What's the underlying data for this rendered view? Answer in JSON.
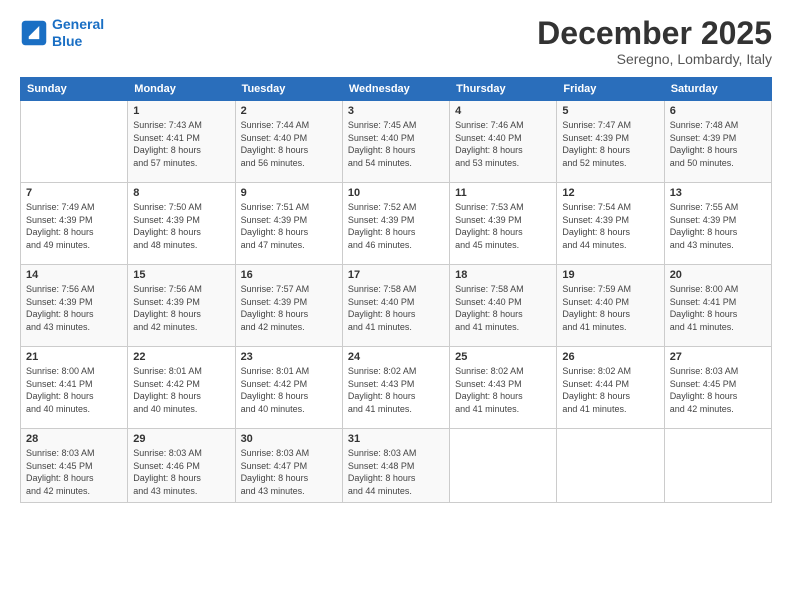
{
  "header": {
    "logo_line1": "General",
    "logo_line2": "Blue",
    "month": "December 2025",
    "location": "Seregno, Lombardy, Italy"
  },
  "weekdays": [
    "Sunday",
    "Monday",
    "Tuesday",
    "Wednesday",
    "Thursday",
    "Friday",
    "Saturday"
  ],
  "weeks": [
    [
      {
        "day": "",
        "info": ""
      },
      {
        "day": "1",
        "info": "Sunrise: 7:43 AM\nSunset: 4:41 PM\nDaylight: 8 hours\nand 57 minutes."
      },
      {
        "day": "2",
        "info": "Sunrise: 7:44 AM\nSunset: 4:40 PM\nDaylight: 8 hours\nand 56 minutes."
      },
      {
        "day": "3",
        "info": "Sunrise: 7:45 AM\nSunset: 4:40 PM\nDaylight: 8 hours\nand 54 minutes."
      },
      {
        "day": "4",
        "info": "Sunrise: 7:46 AM\nSunset: 4:40 PM\nDaylight: 8 hours\nand 53 minutes."
      },
      {
        "day": "5",
        "info": "Sunrise: 7:47 AM\nSunset: 4:39 PM\nDaylight: 8 hours\nand 52 minutes."
      },
      {
        "day": "6",
        "info": "Sunrise: 7:48 AM\nSunset: 4:39 PM\nDaylight: 8 hours\nand 50 minutes."
      }
    ],
    [
      {
        "day": "7",
        "info": "Sunrise: 7:49 AM\nSunset: 4:39 PM\nDaylight: 8 hours\nand 49 minutes."
      },
      {
        "day": "8",
        "info": "Sunrise: 7:50 AM\nSunset: 4:39 PM\nDaylight: 8 hours\nand 48 minutes."
      },
      {
        "day": "9",
        "info": "Sunrise: 7:51 AM\nSunset: 4:39 PM\nDaylight: 8 hours\nand 47 minutes."
      },
      {
        "day": "10",
        "info": "Sunrise: 7:52 AM\nSunset: 4:39 PM\nDaylight: 8 hours\nand 46 minutes."
      },
      {
        "day": "11",
        "info": "Sunrise: 7:53 AM\nSunset: 4:39 PM\nDaylight: 8 hours\nand 45 minutes."
      },
      {
        "day": "12",
        "info": "Sunrise: 7:54 AM\nSunset: 4:39 PM\nDaylight: 8 hours\nand 44 minutes."
      },
      {
        "day": "13",
        "info": "Sunrise: 7:55 AM\nSunset: 4:39 PM\nDaylight: 8 hours\nand 43 minutes."
      }
    ],
    [
      {
        "day": "14",
        "info": "Sunrise: 7:56 AM\nSunset: 4:39 PM\nDaylight: 8 hours\nand 43 minutes."
      },
      {
        "day": "15",
        "info": "Sunrise: 7:56 AM\nSunset: 4:39 PM\nDaylight: 8 hours\nand 42 minutes."
      },
      {
        "day": "16",
        "info": "Sunrise: 7:57 AM\nSunset: 4:39 PM\nDaylight: 8 hours\nand 42 minutes."
      },
      {
        "day": "17",
        "info": "Sunrise: 7:58 AM\nSunset: 4:40 PM\nDaylight: 8 hours\nand 41 minutes."
      },
      {
        "day": "18",
        "info": "Sunrise: 7:58 AM\nSunset: 4:40 PM\nDaylight: 8 hours\nand 41 minutes."
      },
      {
        "day": "19",
        "info": "Sunrise: 7:59 AM\nSunset: 4:40 PM\nDaylight: 8 hours\nand 41 minutes."
      },
      {
        "day": "20",
        "info": "Sunrise: 8:00 AM\nSunset: 4:41 PM\nDaylight: 8 hours\nand 41 minutes."
      }
    ],
    [
      {
        "day": "21",
        "info": "Sunrise: 8:00 AM\nSunset: 4:41 PM\nDaylight: 8 hours\nand 40 minutes."
      },
      {
        "day": "22",
        "info": "Sunrise: 8:01 AM\nSunset: 4:42 PM\nDaylight: 8 hours\nand 40 minutes."
      },
      {
        "day": "23",
        "info": "Sunrise: 8:01 AM\nSunset: 4:42 PM\nDaylight: 8 hours\nand 40 minutes."
      },
      {
        "day": "24",
        "info": "Sunrise: 8:02 AM\nSunset: 4:43 PM\nDaylight: 8 hours\nand 41 minutes."
      },
      {
        "day": "25",
        "info": "Sunrise: 8:02 AM\nSunset: 4:43 PM\nDaylight: 8 hours\nand 41 minutes."
      },
      {
        "day": "26",
        "info": "Sunrise: 8:02 AM\nSunset: 4:44 PM\nDaylight: 8 hours\nand 41 minutes."
      },
      {
        "day": "27",
        "info": "Sunrise: 8:03 AM\nSunset: 4:45 PM\nDaylight: 8 hours\nand 42 minutes."
      }
    ],
    [
      {
        "day": "28",
        "info": "Sunrise: 8:03 AM\nSunset: 4:45 PM\nDaylight: 8 hours\nand 42 minutes."
      },
      {
        "day": "29",
        "info": "Sunrise: 8:03 AM\nSunset: 4:46 PM\nDaylight: 8 hours\nand 43 minutes."
      },
      {
        "day": "30",
        "info": "Sunrise: 8:03 AM\nSunset: 4:47 PM\nDaylight: 8 hours\nand 43 minutes."
      },
      {
        "day": "31",
        "info": "Sunrise: 8:03 AM\nSunset: 4:48 PM\nDaylight: 8 hours\nand 44 minutes."
      },
      {
        "day": "",
        "info": ""
      },
      {
        "day": "",
        "info": ""
      },
      {
        "day": "",
        "info": ""
      }
    ]
  ]
}
